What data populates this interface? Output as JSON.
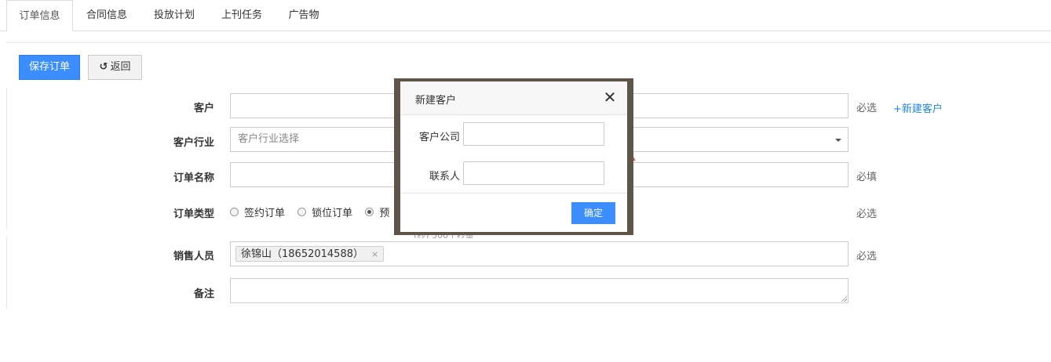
{
  "tabs": [
    {
      "label": "订单信息",
      "active": true
    },
    {
      "label": "合同信息",
      "active": false
    },
    {
      "label": "投放计划",
      "active": false
    },
    {
      "label": "上刊任务",
      "active": false
    },
    {
      "label": "广告物",
      "active": false
    }
  ],
  "toolbar": {
    "save_label": "保存订单",
    "back_icon": "undo-icon",
    "back_label": "返回"
  },
  "form": {
    "customer": {
      "label": "客户",
      "value": "",
      "hint": "必选",
      "link": "+新建客户"
    },
    "industry": {
      "label": "客户行业",
      "placeholder": "客户行业选择"
    },
    "order_name": {
      "label": "订单名称",
      "value": "",
      "hint": "必填"
    },
    "order_type": {
      "label": "订单类型",
      "options": [
        {
          "label": "签约订单",
          "checked": false
        },
        {
          "label": "锁位订单",
          "checked": false
        },
        {
          "label": "预",
          "checked": true
        }
      ],
      "hint": "必选",
      "partial_text": "(秒)    500 | 秒量"
    },
    "sales": {
      "label": "销售人员",
      "tag": "徐锦山（18652014588）",
      "tag_remove": "×",
      "hint": "必选"
    },
    "remark": {
      "label": "备注",
      "value": ""
    }
  },
  "modal": {
    "title": "新建客户",
    "close_icon": "close-icon",
    "close_glyph": "✕",
    "company_label": "客户公司",
    "company_value": "",
    "contact_label": "联系人",
    "contact_value": "",
    "ok_label": "确定"
  },
  "colors": {
    "primary": "#3c8dfd",
    "link": "#1e88e5",
    "modal_frame": "#5e5448"
  }
}
